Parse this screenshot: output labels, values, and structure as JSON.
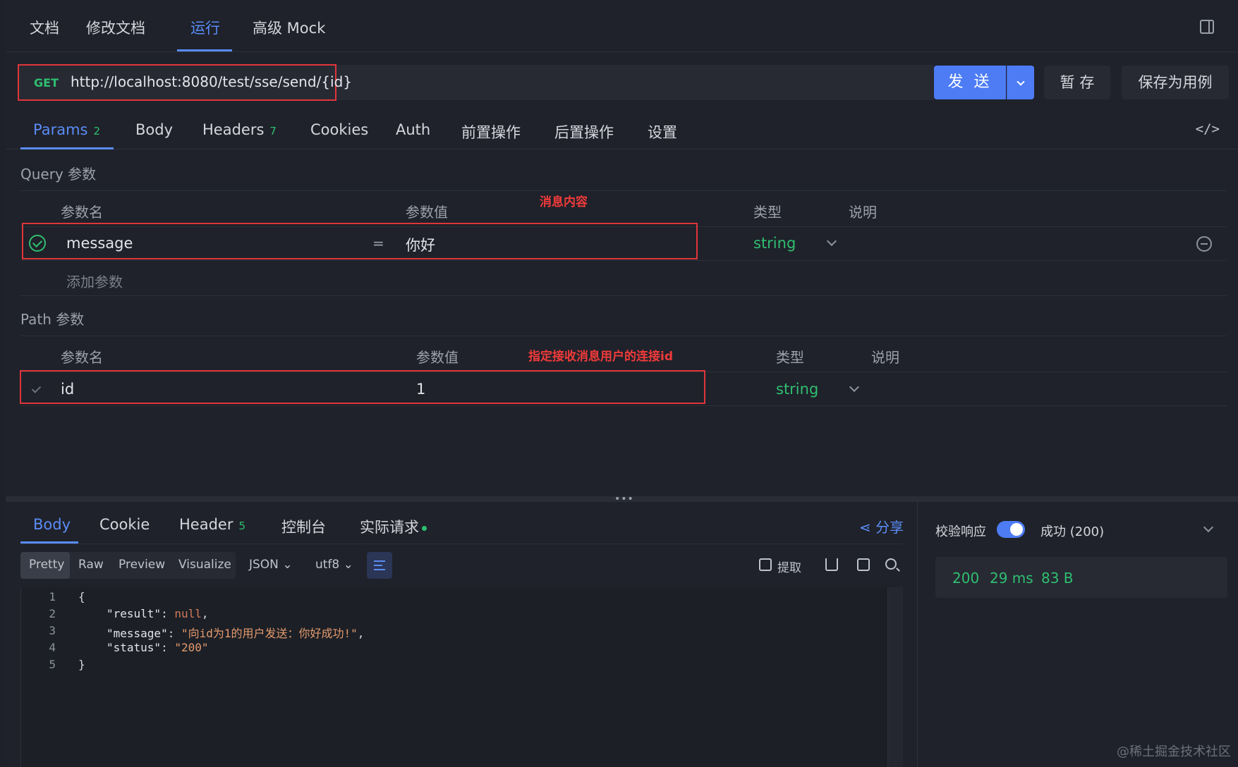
{
  "top_tabs": [
    "文档",
    "修改文档",
    "运行",
    "高级 Mock"
  ],
  "request": {
    "method": "GET",
    "url": "http://localhost:8080/test/sse/send/{id}",
    "send_label": "发 送",
    "stash_label": "暂 存",
    "save_case_label": "保存为用例"
  },
  "sub_tabs": {
    "params": "Params",
    "params_count": "2",
    "body": "Body",
    "headers": "Headers",
    "headers_count": "7",
    "cookies": "Cookies",
    "auth": "Auth",
    "pre": "前置操作",
    "post": "后置操作",
    "settings": "设置",
    "code_icon": "</>"
  },
  "query": {
    "title": "Query 参数",
    "col_name": "参数名",
    "col_value": "参数值",
    "col_type": "类型",
    "col_desc": "说明",
    "annotation": "消息内容",
    "row": {
      "name": "message",
      "eq": "=",
      "value": "你好",
      "type": "string"
    },
    "add": "添加参数"
  },
  "path": {
    "title": "Path 参数",
    "col_name": "参数名",
    "col_value": "参数值",
    "col_type": "类型",
    "col_desc": "说明",
    "annotation": "指定接收消息用户的连接id",
    "row": {
      "name": "id",
      "value": "1",
      "type": "string"
    }
  },
  "response": {
    "tabs": {
      "body": "Body",
      "cookie": "Cookie",
      "header": "Header",
      "header_count": "5",
      "console": "控制台",
      "actual": "实际请求"
    },
    "share": "分享",
    "views": [
      "Pretty",
      "Raw",
      "Preview",
      "Visualize"
    ],
    "format": "JSON",
    "encoding": "utf8",
    "extract": "提取",
    "code_lines": [
      {
        "n": "1"
      },
      {
        "n": "2"
      },
      {
        "n": "3"
      },
      {
        "n": "4"
      },
      {
        "n": "5"
      }
    ],
    "json": {
      "open": "{",
      "k_result": "\"result\"",
      "v_result": "null",
      "k_message": "\"message\"",
      "v_message": "\"向id为1的用户发送：你好成功!\"",
      "k_status": "\"status\"",
      "v_status": "\"200\"",
      "close": "}"
    }
  },
  "right": {
    "verify": "校验响应",
    "success": "成功 (200)",
    "status": "200",
    "time": "29 ms",
    "size": "83 B"
  },
  "watermark": "@稀土掘金技术社区",
  "colors": {
    "accent": "#4d7cf5",
    "success": "#2fbf71",
    "annotation": "#e0353a"
  }
}
